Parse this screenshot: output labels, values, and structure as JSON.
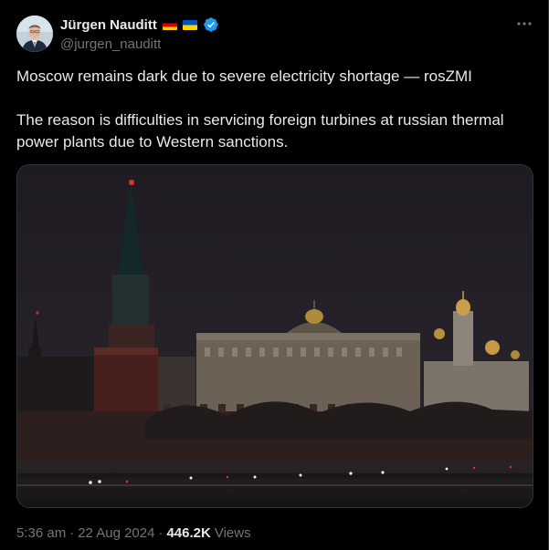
{
  "author": {
    "display_name": "Jürgen Nauditt",
    "handle": "@jurgen_nauditt",
    "flags": [
      "germany-flag",
      "ukraine-flag"
    ],
    "verified": true,
    "verified_color": "#1d9bf0"
  },
  "tweet": {
    "line1": "Moscow remains dark due to severe electricity shortage — rosZMI",
    "line2": "The reason is difficulties in servicing foreign turbines at russian thermal power plants due to Western sanctions."
  },
  "meta": {
    "time": "5:36 am",
    "separator": "·",
    "date": "22 Aug 2024",
    "separator2": "·",
    "views_count": "446.2K",
    "views_label": "Views"
  },
  "colors": {
    "background": "#000000",
    "text": "#e7e9ea",
    "muted": "#71767b",
    "border": "#2f3336"
  }
}
